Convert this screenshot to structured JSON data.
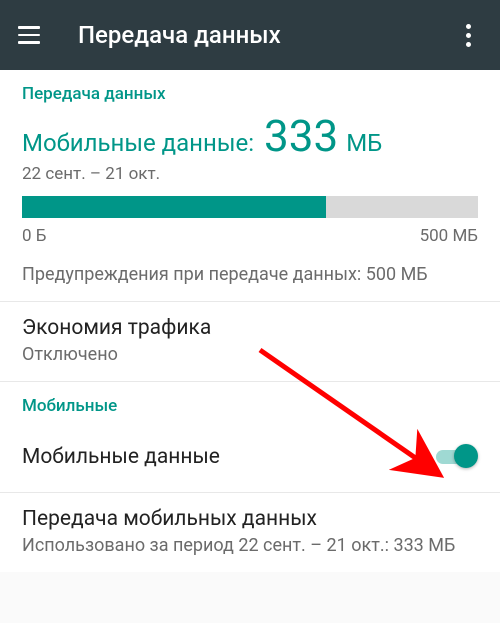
{
  "appbar": {
    "title": "Передача данных"
  },
  "usage": {
    "section_title": "Передача данных",
    "label": "Мобильные данные:",
    "value": "333",
    "unit": "МБ",
    "date_range": "22 сент. – 21 окт.",
    "bar_min_label": "0 Б",
    "bar_max_label": "500 МБ",
    "bar_fill_percent": 66.6,
    "warning_text": "Предупреждения при передаче данных: 500 МБ"
  },
  "data_saver": {
    "title": "Экономия трафика",
    "status": "Отключено"
  },
  "mobile_header": "Мобильные",
  "mobile_data": {
    "title": "Мобильные данные",
    "enabled": true
  },
  "mobile_usage": {
    "title": "Передача мобильных данных",
    "subtitle": "Использовано за период 22 сент. – 21 окт.: 333 МБ"
  },
  "colors": {
    "accent": "#009688",
    "appbar": "#2e3c42",
    "arrow": "#ff0000"
  }
}
